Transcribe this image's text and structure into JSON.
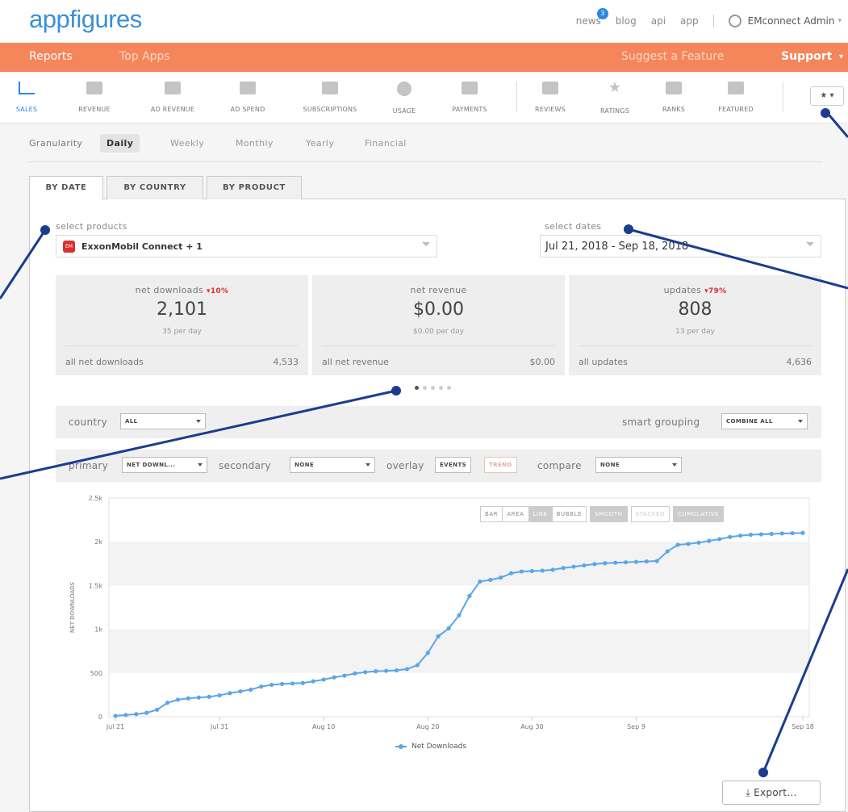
{
  "header": {
    "logo": "appfigures",
    "news": "news",
    "news_badge": "3",
    "blog": "blog",
    "api": "api",
    "app": "app",
    "user": "EMconnect Admin"
  },
  "nav": {
    "reports": "Reports",
    "top_apps": "Top Apps",
    "suggest": "Suggest a Feature",
    "support": "Support"
  },
  "toolbar": {
    "items": [
      {
        "label": "SALES",
        "icon": "line-chart-icon"
      },
      {
        "label": "REVENUE",
        "icon": "money-icon"
      },
      {
        "label": "AD REVENUE",
        "icon": "ad-revenue-icon"
      },
      {
        "label": "AD SPEND",
        "icon": "ad-spend-icon"
      },
      {
        "label": "SUBSCRIPTIONS",
        "icon": "calendar-icon"
      },
      {
        "label": "USAGE",
        "icon": "gauge-icon"
      },
      {
        "label": "PAYMENTS",
        "icon": "card-icon"
      },
      {
        "label": "REVIEWS",
        "icon": "chat-icon"
      },
      {
        "label": "RATINGS",
        "icon": "star-icon"
      },
      {
        "label": "RANKS",
        "icon": "bars-icon"
      },
      {
        "label": "FEATURED",
        "icon": "megaphone-icon"
      }
    ],
    "pin": "★ ▾"
  },
  "granularity": {
    "label": "Granularity",
    "options": [
      "Daily",
      "Weekly",
      "Monthly",
      "Yearly",
      "Financial"
    ],
    "selected": "Daily"
  },
  "tabs": [
    "BY DATE",
    "BY COUNTRY",
    "BY PRODUCT"
  ],
  "products": {
    "label": "select products",
    "value": "ExxonMobil Connect + 1",
    "app_icon_text": "EM"
  },
  "dates": {
    "label": "select dates",
    "value": "Jul 21, 2018 - Sep 18, 2018"
  },
  "cards": [
    {
      "title": "net downloads",
      "change": "▾10%",
      "value": "2,101",
      "sub": "35 per day",
      "foot_label": "all net downloads",
      "foot_value": "4,533"
    },
    {
      "title": "net revenue",
      "change": "",
      "value": "$0.00",
      "sub": "$0.00 per day",
      "foot_label": "all net revenue",
      "foot_value": "$0.00"
    },
    {
      "title": "updates",
      "change": "▾79%",
      "value": "808",
      "sub": "13 per day",
      "foot_label": "all updates",
      "foot_value": "4,636"
    }
  ],
  "filters": {
    "country_label": "country",
    "country_value": "ALL",
    "smart_label": "smart grouping",
    "smart_value": "COMBINE ALL",
    "primary_label": "primary",
    "primary_value": "NET DOWNL...",
    "secondary_label": "secondary",
    "secondary_value": "NONE",
    "overlay_label": "overlay",
    "overlay_events": "EVENTS",
    "overlay_trend": "TREND",
    "compare_label": "compare",
    "compare_value": "NONE"
  },
  "chart_controls": [
    "BAR",
    "AREA",
    "LINE",
    "BUBBLE",
    "SMOOTH",
    "STACKED",
    "CUMULATIVE"
  ],
  "export": "Export...",
  "chart_data": {
    "type": "line",
    "ylabel": "NET DOWNLOADS",
    "xlabel": "",
    "ylim": [
      0,
      2500
    ],
    "yticks": [
      "0",
      "500",
      "1k",
      "1.5k",
      "2k",
      "2.5k"
    ],
    "xticks": [
      "Jul 21",
      "Jul 31",
      "Aug 10",
      "Aug 20",
      "Aug 30",
      "Sep 9",
      "Sep 18"
    ],
    "legend_position": "bottom",
    "series": [
      {
        "name": "Net Downloads",
        "color": "#5aa6e8",
        "values": [
          10,
          20,
          30,
          45,
          80,
          160,
          195,
          210,
          220,
          228,
          245,
          270,
          290,
          310,
          345,
          365,
          375,
          380,
          385,
          405,
          425,
          450,
          470,
          495,
          510,
          520,
          525,
          530,
          545,
          590,
          730,
          920,
          1010,
          1160,
          1380,
          1545,
          1565,
          1590,
          1640,
          1660,
          1665,
          1670,
          1680,
          1700,
          1715,
          1730,
          1745,
          1755,
          1760,
          1765,
          1770,
          1775,
          1780,
          1890,
          1965,
          1975,
          1990,
          2010,
          2030,
          2055,
          2070,
          2080,
          2085,
          2090,
          2095,
          2098,
          2101
        ]
      }
    ]
  }
}
